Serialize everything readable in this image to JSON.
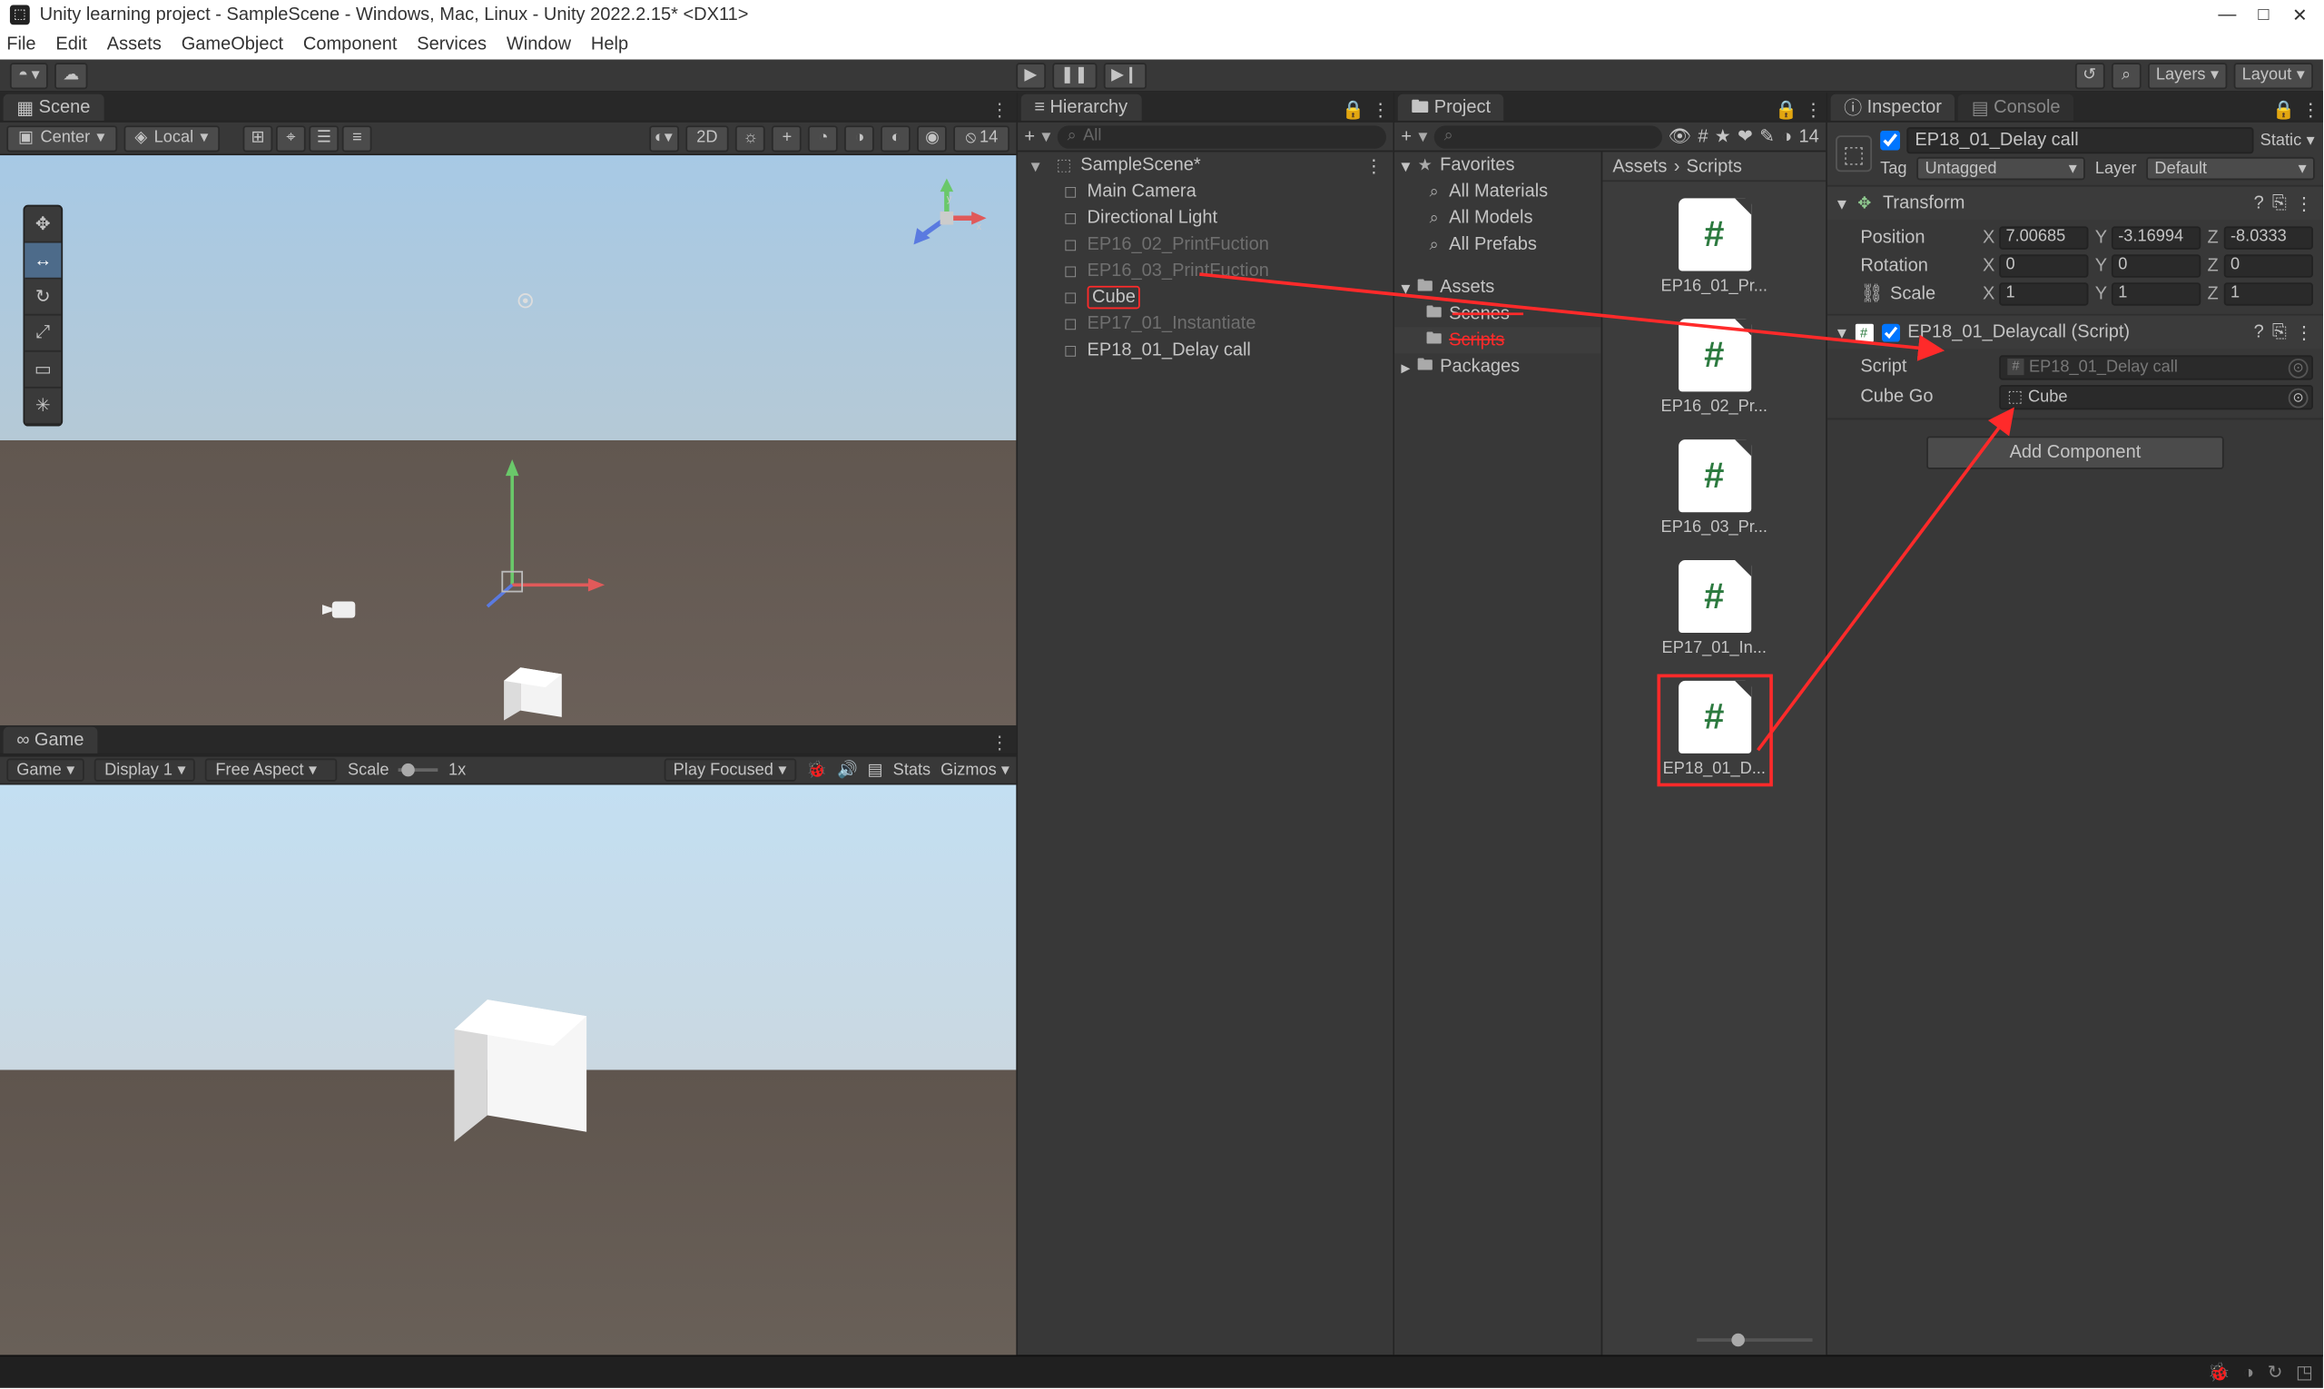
{
  "window": {
    "title": "Unity learning project - SampleScene - Windows, Mac, Linux - Unity 2022.2.15* <DX11>",
    "controls": {
      "minimize": "—",
      "maximize": "□",
      "close": "✕"
    }
  },
  "menu": [
    "File",
    "Edit",
    "Assets",
    "GameObject",
    "Component",
    "Services",
    "Window",
    "Help"
  ],
  "toolbar": {
    "account_icon": "◓",
    "cloud_icon": "☁",
    "play": "▶",
    "pause": "❚❚",
    "step": "▶❙",
    "undo_icon": "↺",
    "search_icon": "⌕",
    "layers": "Layers",
    "layout": "Layout"
  },
  "scene_panel": {
    "tab": "Scene",
    "pivot": "Center",
    "local": "Local",
    "tool_icons": [
      "⊞",
      "⌖",
      "☰",
      "≡"
    ],
    "d2": "2D",
    "right_icons": [
      "☼",
      "+",
      "◔",
      "◑",
      "◐",
      "◉"
    ],
    "overlay_count": "14",
    "tools": [
      "✥",
      "↔",
      "↻",
      "⤢",
      "▭",
      "✳"
    ]
  },
  "game_panel": {
    "tab": "Game",
    "game_dd": "Game",
    "display": "Display 1",
    "aspect": "Free Aspect",
    "scale_label": "Scale",
    "scale_value": "1x",
    "play_focused": "Play Focused",
    "stats": "Stats",
    "gizmos": "Gizmos"
  },
  "hierarchy": {
    "tab": "Hierarchy",
    "plus": "+",
    "search_placeholder": "All",
    "scene": "SampleScene*",
    "items": [
      {
        "name": "Main Camera",
        "dim": false
      },
      {
        "name": "Directional Light",
        "dim": false
      },
      {
        "name": "EP16_02_PrintFuction",
        "dim": true
      },
      {
        "name": "EP16_03_PrintFuction",
        "dim": true
      },
      {
        "name": "Cube",
        "dim": false,
        "highlight": true
      },
      {
        "name": "EP17_01_Instantiate",
        "dim": true
      },
      {
        "name": "EP18_01_Delay call",
        "dim": false
      }
    ]
  },
  "project": {
    "tab": "Project",
    "plus": "+",
    "search_placeholder": "",
    "icons": [
      "👁",
      "#",
      "★",
      "❤",
      "✎",
      "◑"
    ],
    "hidden_count": "14",
    "tree": {
      "favorites": "Favorites",
      "fav_children": [
        "All Materials",
        "All Models",
        "All Prefabs"
      ],
      "assets": "Assets",
      "assets_children": [
        "Scenes",
        "Scripts"
      ],
      "packages": "Packages"
    },
    "breadcrumb": [
      "Assets",
      "Scripts"
    ],
    "items": [
      {
        "label": "EP16_01_Pr..."
      },
      {
        "label": "EP16_02_Pr..."
      },
      {
        "label": "EP16_03_Pr..."
      },
      {
        "label": "EP17_01_In..."
      },
      {
        "label": "EP18_01_D...",
        "selected": true
      }
    ]
  },
  "inspector": {
    "tab": "Inspector",
    "console_tab": "Console",
    "go_name": "EP18_01_Delay call",
    "static_label": "Static",
    "tag_label": "Tag",
    "tag_value": "Untagged",
    "layer_label": "Layer",
    "layer_value": "Default",
    "transform": {
      "title": "Transform",
      "position_label": "Position",
      "rotation_label": "Rotation",
      "scale_label": "Scale",
      "pos": {
        "x": "7.00685",
        "y": "-3.16994",
        "z": "-8.0333"
      },
      "rot": {
        "x": "0",
        "y": "0",
        "z": "0"
      },
      "scl": {
        "x": "1",
        "y": "1",
        "z": "1"
      }
    },
    "script_comp": {
      "title": "EP18_01_Delaycall (Script)",
      "script_label": "Script",
      "script_value": "EP18_01_Delay call",
      "cubego_label": "Cube Go",
      "cubego_value": "Cube"
    },
    "add_component": "Add Component"
  },
  "colors": {
    "red": "#ff2a2a"
  }
}
